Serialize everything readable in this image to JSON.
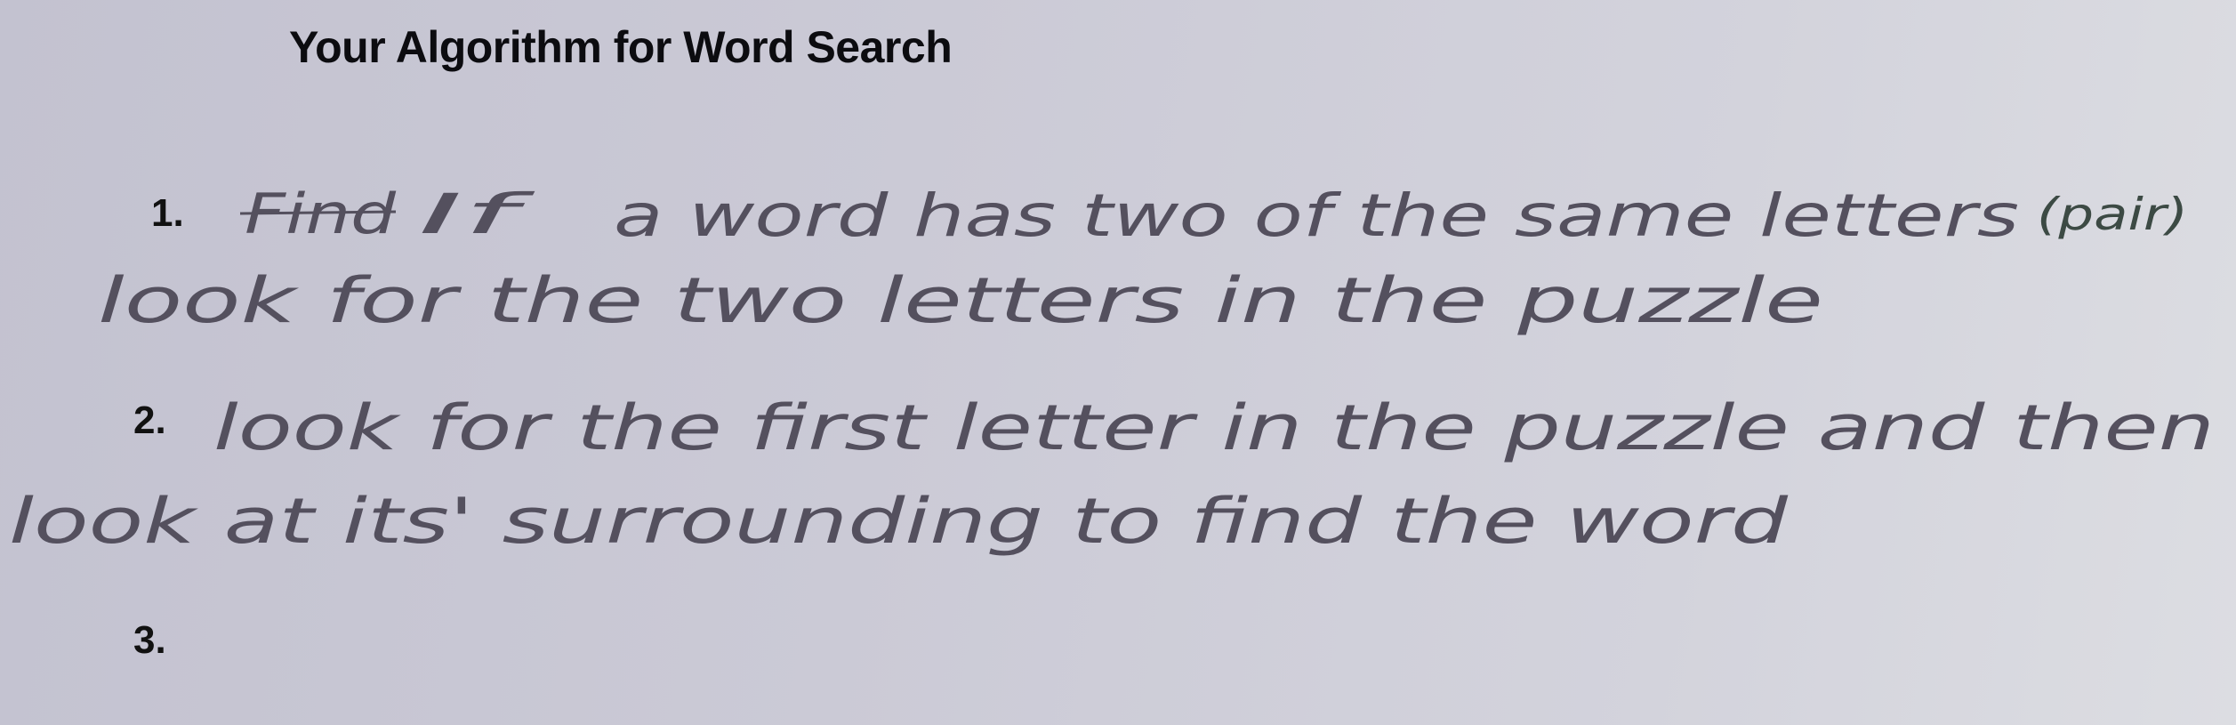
{
  "title": "Your Algorithm for Word Search",
  "items": [
    {
      "number": "1.",
      "struck_word": "Find",
      "lines": [
        "If",
        "a word has two of the same letters",
        "(pair)",
        "look for the two letters in the puzzle"
      ]
    },
    {
      "number": "2.",
      "lines": [
        "look for the first letter in the puzzle and then",
        "look at its' surrounding to find the word"
      ]
    },
    {
      "number": "3.",
      "lines": []
    }
  ]
}
